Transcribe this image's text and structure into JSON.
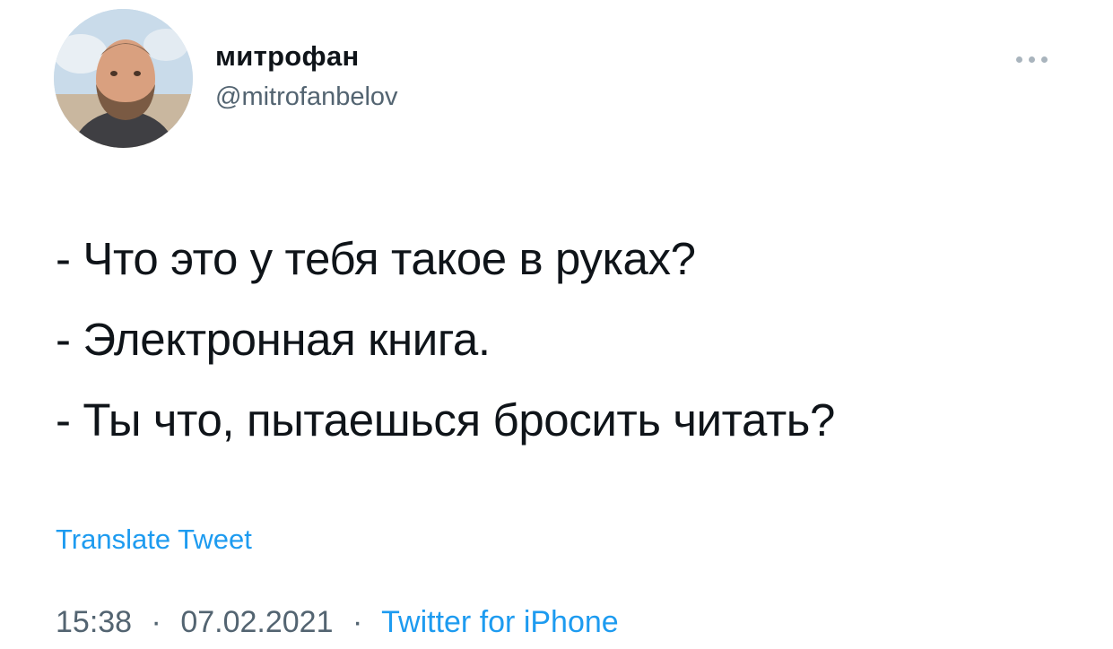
{
  "author": {
    "display_name": "митрофан",
    "handle": "@mitrofanbelov"
  },
  "tweet": {
    "lines": [
      "- Что это у тебя такое в руках?",
      "- Электронная книга.",
      "- Ты что, пытаешься бросить читать?"
    ],
    "translate_label": "Translate Tweet"
  },
  "meta": {
    "time": "15:38",
    "separator": "·",
    "date": "07.02.2021",
    "source": "Twitter for iPhone"
  },
  "colors": {
    "text": "#0f1419",
    "secondary": "#536471",
    "link": "#1d9bf0"
  },
  "icons": {
    "more": "more-horizontal-icon"
  }
}
